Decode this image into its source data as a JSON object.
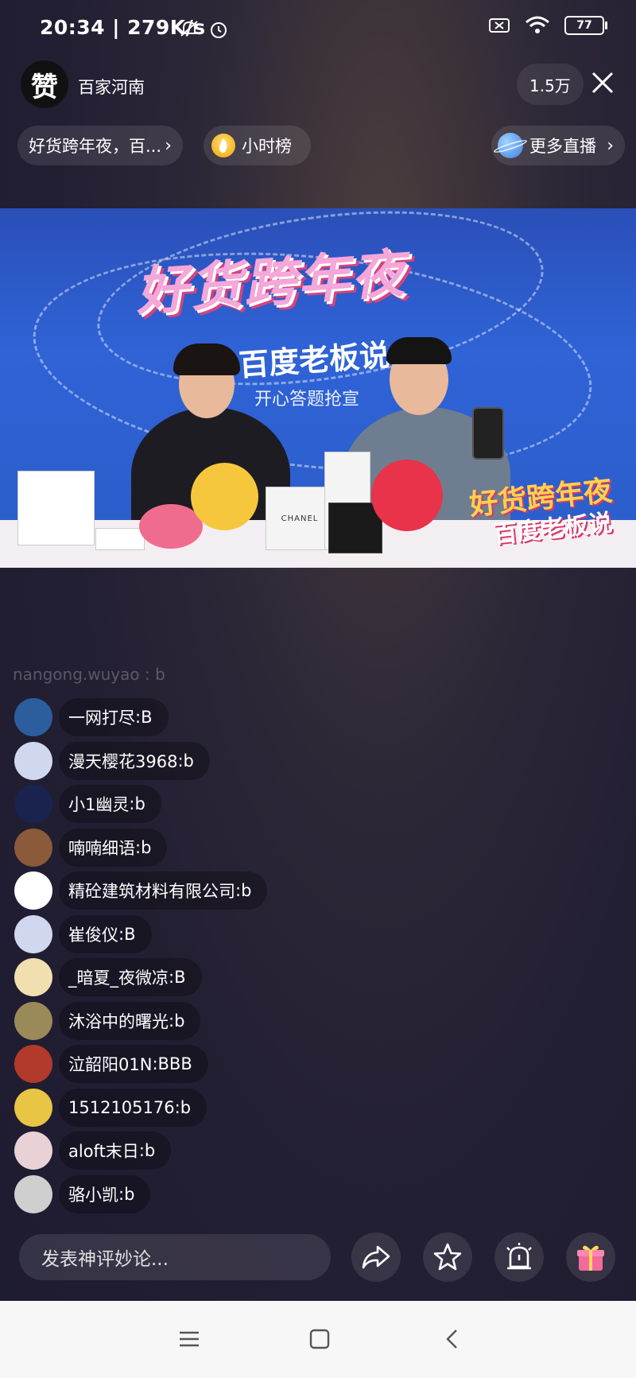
{
  "status_bar": {
    "time": "20:34 | 279K/s",
    "battery": "77"
  },
  "header": {
    "anchor_avatar_glyph": "赞",
    "anchor_name": "百家河南",
    "viewer_count": "1.5万"
  },
  "chips": {
    "topic": "好货跨年夜，百...",
    "rank": "小时榜",
    "more_live": "更多直播"
  },
  "video": {
    "banner_title": "好货跨年夜",
    "banner_sub": "百度老板说",
    "banner_line": "开心答题抢宣",
    "stamp_title": "好货跨年夜",
    "stamp_sub": "百度老板说",
    "box_label": "CHANEL"
  },
  "comments": {
    "faded": "nangong.wuyao : b",
    "items": [
      {
        "user": "一网打尽",
        "text": "B",
        "avatar_color": "#2c5e9e"
      },
      {
        "user": "漫天樱花3968",
        "text": "b",
        "avatar_color": "#cfd8ee"
      },
      {
        "user": "小1幽灵",
        "text": "b",
        "avatar_color": "#1a2350"
      },
      {
        "user": "喃喃细语",
        "text": "b",
        "avatar_color": "#8a5a3a"
      },
      {
        "user": "精砼建筑材料有限公司",
        "text": "b",
        "avatar_color": "#ffffff"
      },
      {
        "user": "崔俊仪",
        "text": "B",
        "avatar_color": "#cfd8ee"
      },
      {
        "user": "_暗夏_夜微凉",
        "text": "B",
        "avatar_color": "#f2dfb0"
      },
      {
        "user": "沐浴中的曙光",
        "text": "b",
        "avatar_color": "#9a8a5a"
      },
      {
        "user": "泣韶阳01N",
        "text": "BBB",
        "avatar_color": "#b23a2a"
      },
      {
        "user": "1512105176",
        "text": "b",
        "avatar_color": "#e8c542"
      },
      {
        "user": "aloft末日",
        "text": "b",
        "avatar_color": "#e8d2d6"
      },
      {
        "user": "骆小凯",
        "text": "b",
        "avatar_color": "#cfcfcf"
      }
    ]
  },
  "bottom": {
    "comment_placeholder": "发表神评妙论..."
  },
  "icons": {
    "share": "share-icon",
    "favorite": "star-icon",
    "alarm": "alarm-icon",
    "gift": "gift-icon"
  }
}
